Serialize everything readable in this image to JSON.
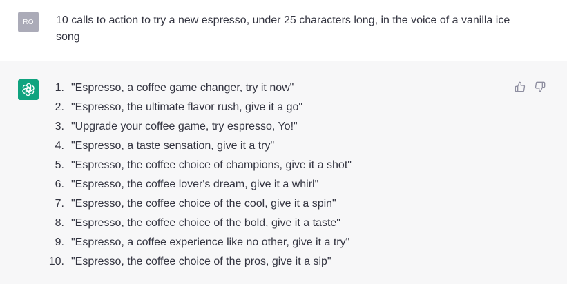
{
  "user_message": {
    "avatar_initials": "RO",
    "text": "10 calls to action to try a new espresso, under 25 characters long, in the voice of a vanilla ice song"
  },
  "assistant_message": {
    "avatar_icon": "openai-logo-icon",
    "items": [
      {
        "number": "1.",
        "text": "\"Espresso, a coffee game changer, try it now\""
      },
      {
        "number": "2.",
        "text": "\"Espresso, the ultimate flavor rush, give it a go\""
      },
      {
        "number": "3.",
        "text": "\"Upgrade your coffee game, try espresso, Yo!\""
      },
      {
        "number": "4.",
        "text": "\"Espresso, a taste sensation, give it a try\""
      },
      {
        "number": "5.",
        "text": "\"Espresso, the coffee choice of champions, give it a shot\""
      },
      {
        "number": "6.",
        "text": "\"Espresso, the coffee lover's dream, give it a whirl\""
      },
      {
        "number": "7.",
        "text": "\"Espresso, the coffee choice of the cool, give it a spin\""
      },
      {
        "number": "8.",
        "text": "\"Espresso, the coffee choice of the bold, give it a taste\""
      },
      {
        "number": "9.",
        "text": "\"Espresso, a coffee experience like no other, give it a try\""
      },
      {
        "number": "10.",
        "text": "\"Espresso, the coffee choice of the pros, give it a sip\""
      }
    ],
    "feedback_icons": [
      "thumbs-up-icon",
      "thumbs-down-icon"
    ]
  },
  "colors": {
    "user_avatar_bg": "#ababb8",
    "bot_avatar_bg": "#10a37f",
    "assistant_row_bg": "#f7f7f8",
    "text": "#343541"
  }
}
